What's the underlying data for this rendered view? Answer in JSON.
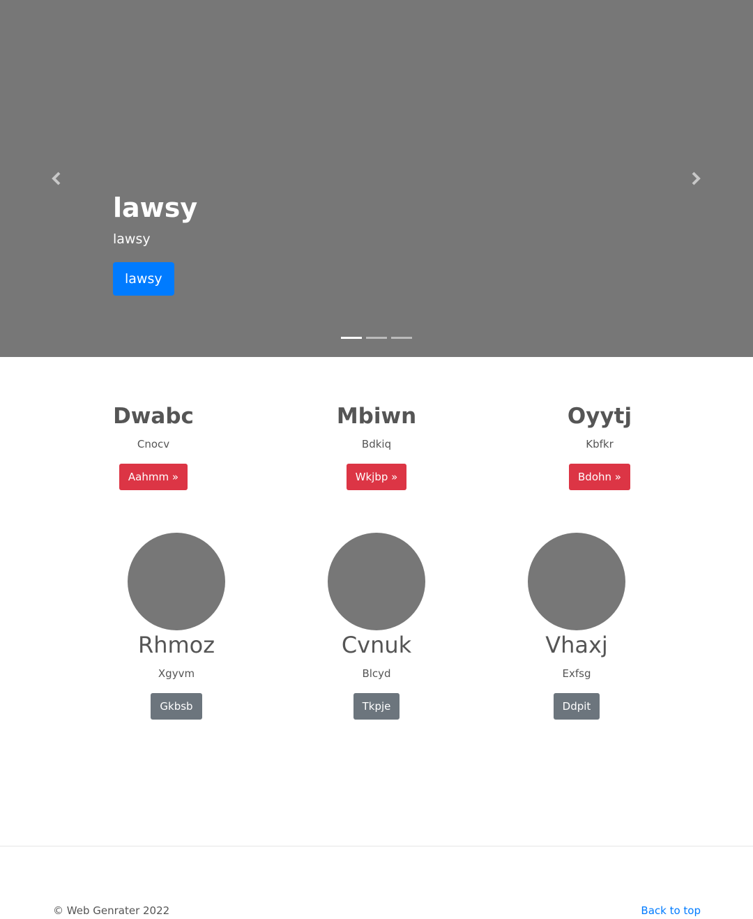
{
  "carousel": {
    "title": "lawsy",
    "text": "lawsy",
    "button_label": "lawsy",
    "prev_icon": "chevron-left-icon",
    "next_icon": "chevron-right-icon",
    "indicators": [
      "slide 1",
      "slide 2",
      "slide 3"
    ],
    "active_index": 0,
    "button_color": "#007bff",
    "background_color": "#777777"
  },
  "features": [
    {
      "heading": "Dwabc",
      "text": "Cnocv",
      "button_label": "Aahmm »"
    },
    {
      "heading": "Mbiwn",
      "text": "Bdkiq",
      "button_label": "Wkjbp »"
    },
    {
      "heading": "Oyytj",
      "text": "Kbfkr",
      "button_label": "Bdohn »"
    }
  ],
  "people": [
    {
      "name": "Rhmoz",
      "text": "Xgyvm",
      "button_label": "Gkbsb"
    },
    {
      "name": "Cvnuk",
      "text": "Blcyd",
      "button_label": "Tkpje"
    },
    {
      "name": "Vhaxj",
      "text": "Exfsg",
      "button_label": "Ddpit"
    }
  ],
  "colors": {
    "danger": "#dc3545",
    "secondary": "#6c757d",
    "link": "#007bff"
  },
  "footer": {
    "copyright": "© Web Genrater 2022",
    "back_to_top": "Back to top"
  }
}
